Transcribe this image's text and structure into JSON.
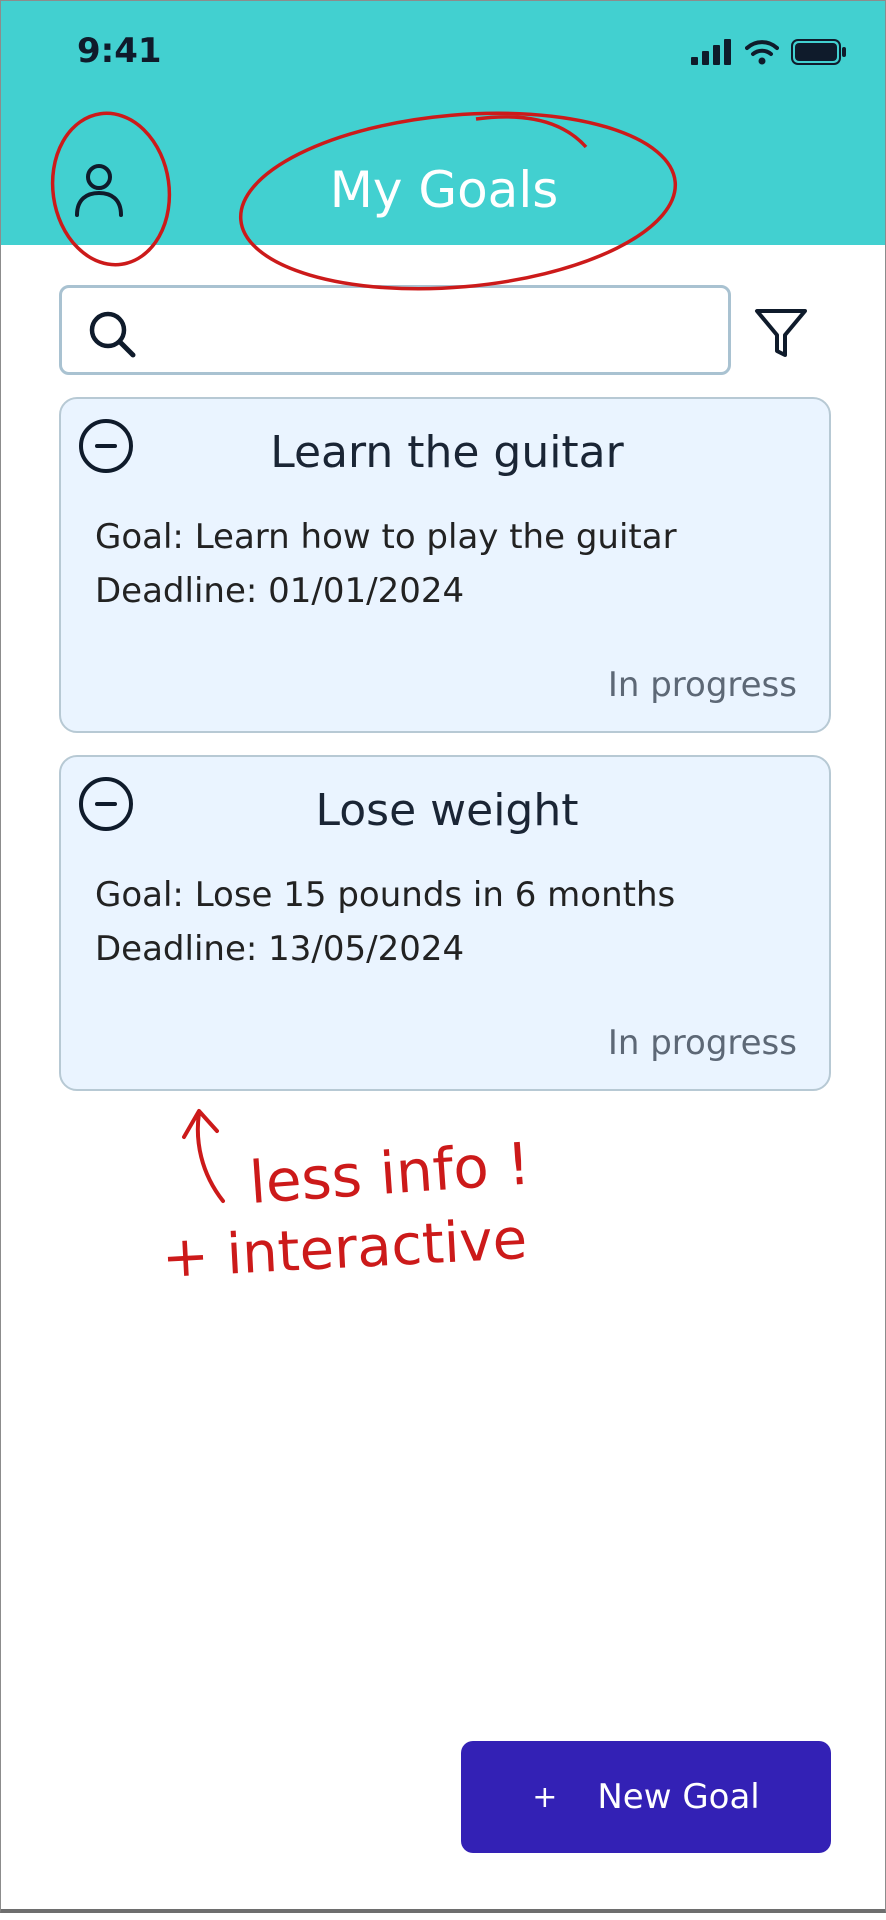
{
  "status_bar": {
    "time": "9:41"
  },
  "header": {
    "title": "My Goals"
  },
  "search": {
    "placeholder": ""
  },
  "goals": [
    {
      "title": "Learn the guitar",
      "goal": "Goal: Learn how to play the guitar",
      "deadline": "Deadline: 01/01/2024",
      "status": "In progress"
    },
    {
      "title": "Lose weight",
      "goal": "Goal: Lose 15 pounds in 6 months",
      "deadline": "Deadline: 13/05/2024",
      "status": "In progress"
    }
  ],
  "annotation": {
    "line1": "less info !",
    "line2": "+ interactive"
  },
  "new_goal": {
    "plus": "+",
    "label": "New Goal"
  },
  "colors": {
    "header": "#42d0d0",
    "accent": "#3321b5",
    "card": "#eaf4ff",
    "annotation": "#cc1a1a"
  }
}
